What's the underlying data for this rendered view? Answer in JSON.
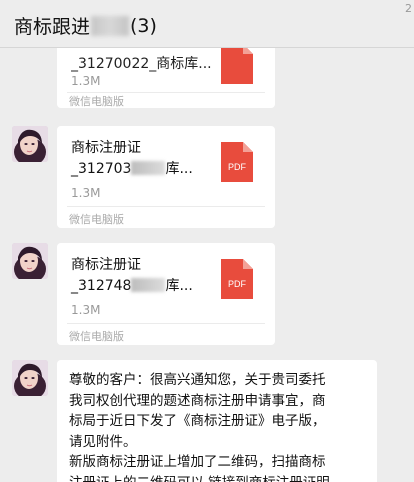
{
  "header": {
    "title_prefix": "商标跟进",
    "member_count": "(3)",
    "corner_mark": "2"
  },
  "messages": [
    {
      "type": "file",
      "file_name": "_31270022_商标库...",
      "file_size": "1.3M",
      "source": "微信电脑版",
      "icon": "pdf-file-icon"
    },
    {
      "type": "file",
      "file_name_line1": "商标注册证",
      "file_name_line2_prefix": "_312703",
      "file_name_line2_suffix": "库...",
      "file_size": "1.3M",
      "source": "微信电脑版",
      "icon": "pdf-file-icon",
      "pdf_label": "PDF"
    },
    {
      "type": "file",
      "file_name_line1": "商标注册证",
      "file_name_line2_prefix": "_312748",
      "file_name_line2_suffix": "库...",
      "file_size": "1.3M",
      "source": "微信电脑版",
      "icon": "pdf-file-icon",
      "pdf_label": "PDF"
    },
    {
      "type": "text",
      "lines": [
        "尊敬的客户：很高兴通知您，关于贵司委托",
        "我司权创代理的题述商标注册申请事宜，商",
        "标局于近日下发了《商标注册证》电子版，",
        "请见附件。",
        "新版商标注册证上增加了二维码，扫描商标",
        "注册证上的二维码可以 链接到商标注册证明"
      ]
    }
  ],
  "colors": {
    "background": "#ededed",
    "bubble": "#ffffff",
    "pdf_red": "#e84c3d",
    "muted_text": "#999999"
  }
}
